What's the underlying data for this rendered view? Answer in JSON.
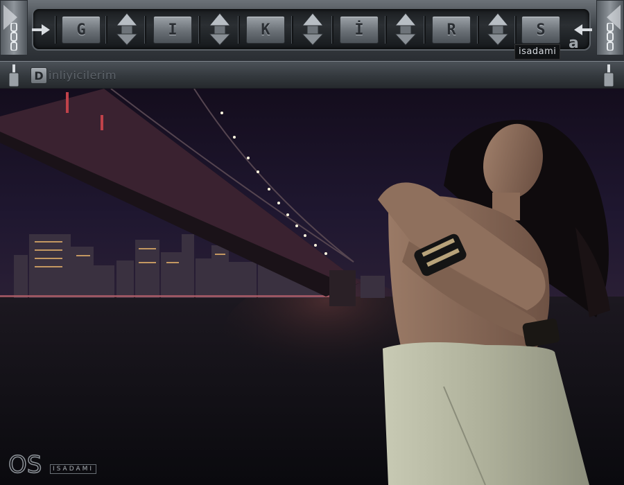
{
  "nav": {
    "letters": [
      "G",
      "I",
      "K",
      "İ",
      "R",
      "S"
    ],
    "brand_tag": "isadami",
    "corner_logo": "a"
  },
  "subbar": {
    "initial": "D",
    "label": "inliyicilerim"
  },
  "footer": {
    "signature": "ISADAMI",
    "signature_mark": "OS"
  },
  "icons": {
    "left_chain": "chain-icon",
    "right_chain": "chain-icon",
    "updown": "up-down-arrow-icon",
    "pins": "pin-icon"
  },
  "colors": {
    "frame": "#3d4247",
    "button": "#7a8086",
    "night_sky": "#160f22",
    "water": "#0d0c12"
  }
}
